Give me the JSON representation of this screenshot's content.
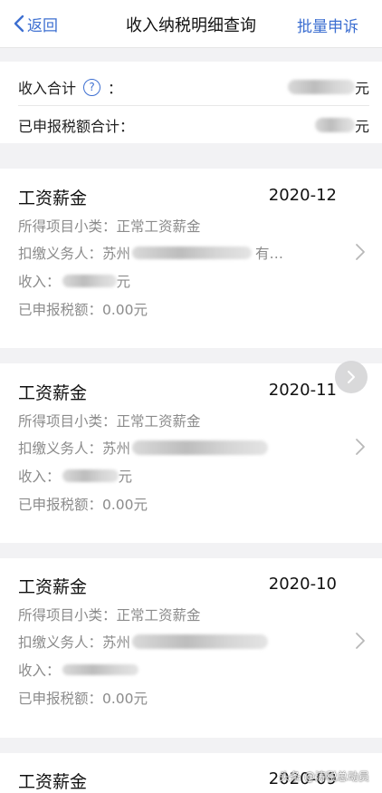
{
  "header": {
    "back_label": "返回",
    "title": "收入纳税明细查询",
    "batch_label": "批量申诉"
  },
  "summary": {
    "income_total_label": "收入合计",
    "help_icon": "?",
    "colon": "：",
    "income_total_unit": "元",
    "tax_total_label": "已申报税额合计：",
    "tax_total_unit": "元"
  },
  "records": [
    {
      "title": "工资薪金",
      "date": "2020-12",
      "subcategory_label": "所得项目小类：",
      "subcategory_value": "正常工资薪金",
      "withholder_label": "扣缴义务人：",
      "withholder_prefix": "苏州",
      "withholder_suffix": "有…",
      "income_label": "收入：",
      "income_unit": "元",
      "tax_label": "已申报税额：",
      "tax_value": "0.00元"
    },
    {
      "title": "工资薪金",
      "date": "2020-11",
      "subcategory_label": "所得项目小类：",
      "subcategory_value": "正常工资薪金",
      "withholder_label": "扣缴义务人：",
      "withholder_prefix": "苏州",
      "withholder_suffix": "",
      "income_label": "收入：",
      "income_unit": "元",
      "tax_label": "已申报税额：",
      "tax_value": "0.00元"
    },
    {
      "title": "工资薪金",
      "date": "2020-10",
      "subcategory_label": "所得项目小类：",
      "subcategory_value": "正常工资薪金",
      "withholder_label": "扣缴义务人：",
      "withholder_prefix": "苏州",
      "withholder_suffix": "",
      "income_label": "收入：",
      "income_unit": "",
      "tax_label": "已申报税额：",
      "tax_value": "0.00元"
    },
    {
      "title": "工资薪金",
      "date": "2020-09"
    }
  ],
  "watermark": "头条 @涛税总动员",
  "colors": {
    "accent": "#3d6fd1",
    "background": "#f2f2f4",
    "muted_text": "#8b8b8b"
  }
}
